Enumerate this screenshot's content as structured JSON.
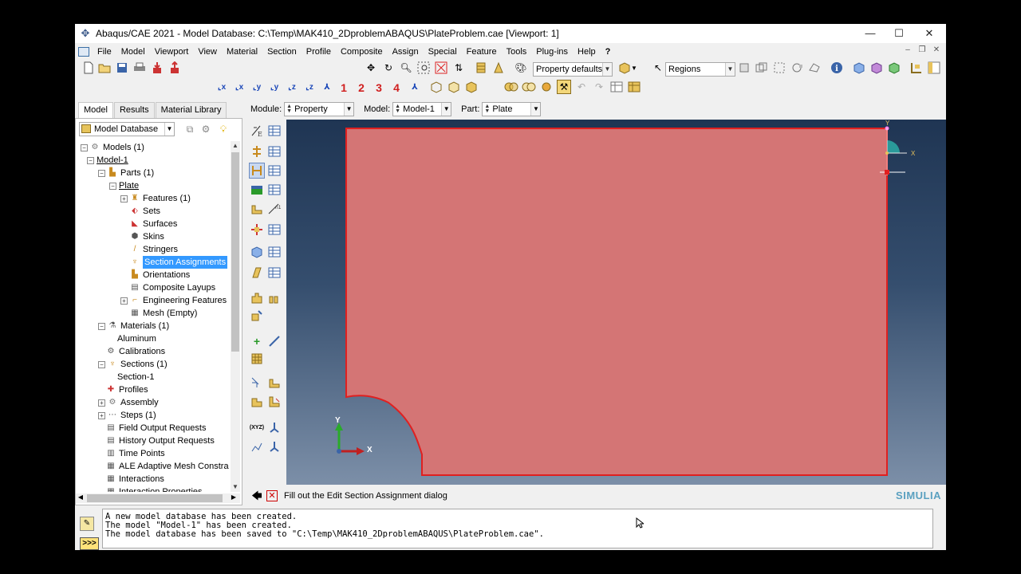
{
  "window": {
    "title": "Abaqus/CAE 2021 - Model Database: C:\\Temp\\MAK410_2DproblemABAQUS\\PlateProblem.cae [Viewport: 1]",
    "minimize": "—",
    "maximize": "☐",
    "close": "✕"
  },
  "menu": [
    "File",
    "Model",
    "Viewport",
    "View",
    "Material",
    "Section",
    "Profile",
    "Composite",
    "Assign",
    "Special",
    "Feature",
    "Tools",
    "Plug-ins",
    "Help",
    "?"
  ],
  "toolbar": {
    "render_style": "Property defaults",
    "selection": "Regions",
    "view_numbers": [
      "1",
      "2",
      "3",
      "4"
    ]
  },
  "tabs": [
    "Model",
    "Results",
    "Material Library"
  ],
  "tree": {
    "header": "Model Database",
    "nodes": [
      {
        "label": "Models (1)"
      },
      {
        "label": "Model-1"
      },
      {
        "label": "Parts (1)"
      },
      {
        "label": "Plate"
      },
      {
        "label": "Features (1)"
      },
      {
        "label": "Sets"
      },
      {
        "label": "Surfaces"
      },
      {
        "label": "Skins"
      },
      {
        "label": "Stringers"
      },
      {
        "label": "Section Assignments"
      },
      {
        "label": "Orientations"
      },
      {
        "label": "Composite Layups"
      },
      {
        "label": "Engineering Features"
      },
      {
        "label": "Mesh (Empty)"
      },
      {
        "label": "Materials (1)"
      },
      {
        "label": "Aluminum"
      },
      {
        "label": "Calibrations"
      },
      {
        "label": "Sections (1)"
      },
      {
        "label": "Section-1"
      },
      {
        "label": "Profiles"
      },
      {
        "label": "Assembly"
      },
      {
        "label": "Steps (1)"
      },
      {
        "label": "Field Output Requests"
      },
      {
        "label": "History Output Requests"
      },
      {
        "label": "Time Points"
      },
      {
        "label": "ALE Adaptive Mesh Constraints"
      },
      {
        "label": "Interactions"
      },
      {
        "label": "Interaction Properties"
      }
    ]
  },
  "context": {
    "module_label": "Module:",
    "module": "Property",
    "model_label": "Model:",
    "model": "Model-1",
    "part_label": "Part:",
    "part": "Plate"
  },
  "viewport": {
    "triad_small": {
      "y": "Y",
      "x": "X"
    },
    "triad": {
      "y": "Y",
      "x": "X"
    },
    "colors": {
      "part_fill": "#d47575",
      "part_edge": "#e02020"
    }
  },
  "prompt": {
    "message": "Fill out the Edit Section Assignment dialog",
    "brand": "SIMULIA"
  },
  "messages": [
    "A new model database has been created.",
    "The model \"Model-1\" has been created.",
    "The model database has been saved to \"C:\\Temp\\MAK410_2DproblemABAQUS\\PlateProblem.cae\"."
  ],
  "command_prompt": ">>>"
}
